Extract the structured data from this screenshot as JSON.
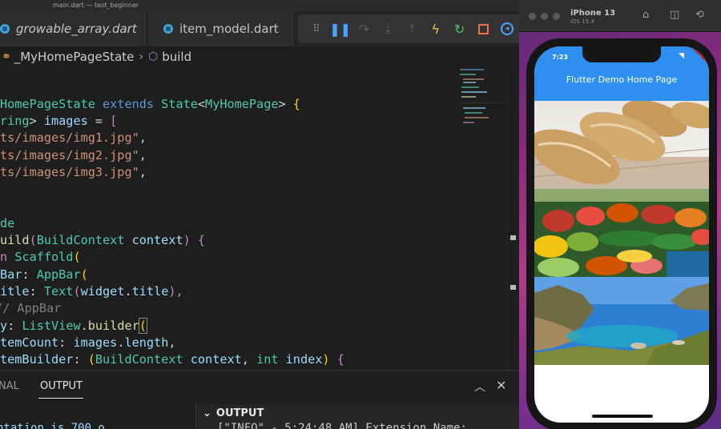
{
  "window_title": "main.dart — test_beginner",
  "tabs": [
    {
      "label": "growable_array.dart"
    },
    {
      "label": "item_model.dart"
    }
  ],
  "debug_toolbar": [
    {
      "icon": "drag-handle-icon"
    },
    {
      "icon": "pause-icon"
    },
    {
      "icon": "step-over-icon"
    },
    {
      "icon": "step-into-icon"
    },
    {
      "icon": "step-out-icon"
    },
    {
      "icon": "hot-reload-icon"
    },
    {
      "icon": "restart-icon"
    },
    {
      "icon": "stop-icon"
    },
    {
      "icon": "devtools-icon"
    }
  ],
  "breadcrumb": {
    "class_name": "_MyHomePageState",
    "method_name": "build"
  },
  "code": {
    "l1": [
      "HomePageState",
      " extends ",
      "State",
      "<",
      "MyHomePage",
      "> ",
      "{"
    ],
    "l2": [
      "ring",
      "> ",
      "images",
      " = ",
      "["
    ],
    "l3": [
      "ts/images/img1.jpg\"",
      ","
    ],
    "l4": [
      "ts/images/img2.jpg\"",
      ","
    ],
    "l5": [
      "ts/images/img3.jpg\"",
      ","
    ],
    "l6": [
      "de"
    ],
    "l7": [
      "uild",
      "(",
      "BuildContext",
      " context",
      ") ",
      "{"
    ],
    "l8": [
      "n ",
      "Scaffold",
      "("
    ],
    "l9": [
      "Bar",
      ": ",
      "AppBar",
      "("
    ],
    "l10": [
      "itle",
      ": ",
      "Text",
      "(",
      "widget",
      ".",
      "title",
      "),"
    ],
    "l11": [
      "// AppBar"
    ],
    "l12": [
      "y",
      ": ",
      "ListView",
      ".",
      "builder",
      "("
    ],
    "l13": [
      "temCount",
      ": ",
      "images",
      ".",
      "length",
      ","
    ],
    "l14": [
      "temBuilder",
      ": ",
      "(",
      "BuildContext",
      " context",
      ", ",
      "int",
      " index",
      ") ",
      "{"
    ]
  },
  "panel": {
    "tab_terminal": "NAL",
    "tab_output": "OUTPUT",
    "output_header": "OUTPUT",
    "output_line": "[\"INFO\" - 5:24:48 AM] Extension Name:",
    "left_line": "ntation is 700 o"
  },
  "simulator": {
    "device_name": "iPhone 13",
    "os_version": "iOS 15.4",
    "app": {
      "status_time": "7:23",
      "debug_banner": "DEBUG",
      "appbar_title": "Flutter Demo Home Page"
    }
  }
}
